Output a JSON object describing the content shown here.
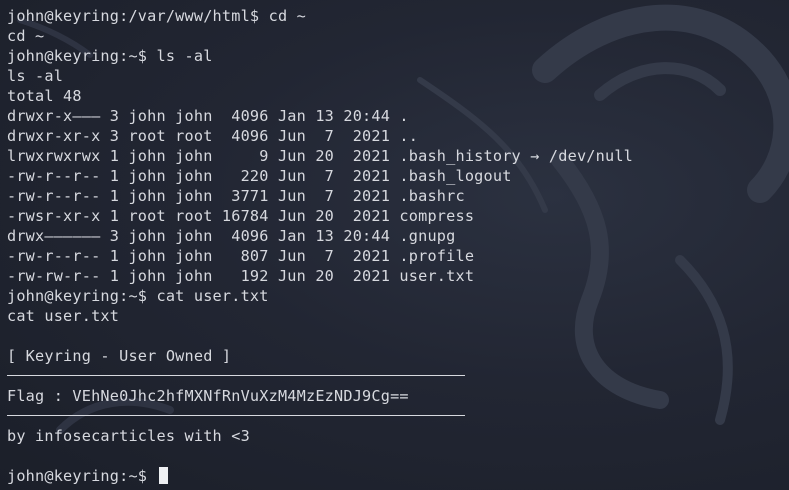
{
  "terminal": {
    "lines": [
      "john@keyring:/var/www/html$ cd ~",
      "cd ~",
      "john@keyring:~$ ls -al",
      "ls -al",
      "total 48",
      "drwxr-x——— 3 john john  4096 Jan 13 20:44 .",
      "drwxr-xr-x 3 root root  4096 Jun  7  2021 ..",
      "lrwxrwxrwx 1 john john     9 Jun 20  2021 .bash_history → /dev/null",
      "-rw-r--r-- 1 john john   220 Jun  7  2021 .bash_logout",
      "-rw-r--r-- 1 john john  3771 Jun  7  2021 .bashrc",
      "-rwsr-xr-x 1 root root 16784 Jun 20  2021 compress",
      "drwx—————— 3 john john  4096 Jan 13 20:44 .gnupg",
      "-rw-r--r-- 1 john john   807 Jun  7  2021 .profile",
      "-rw-rw-r-- 1 john john   192 Jun 20  2021 user.txt",
      "john@keyring:~$ cat user.txt",
      "cat user.txt",
      "",
      "[ Keyring - User Owned ]",
      "",
      "Flag : VEhNe0Jhc2hfMXNfRnVuXzM4MzEzNDJ9Cg==",
      "",
      "by infosecarticles with <3",
      ""
    ],
    "prompt": "john@keyring:~$ "
  },
  "colors": {
    "background": "#1f2430",
    "text": "#d7d9df",
    "cursor": "#eef0f3"
  }
}
